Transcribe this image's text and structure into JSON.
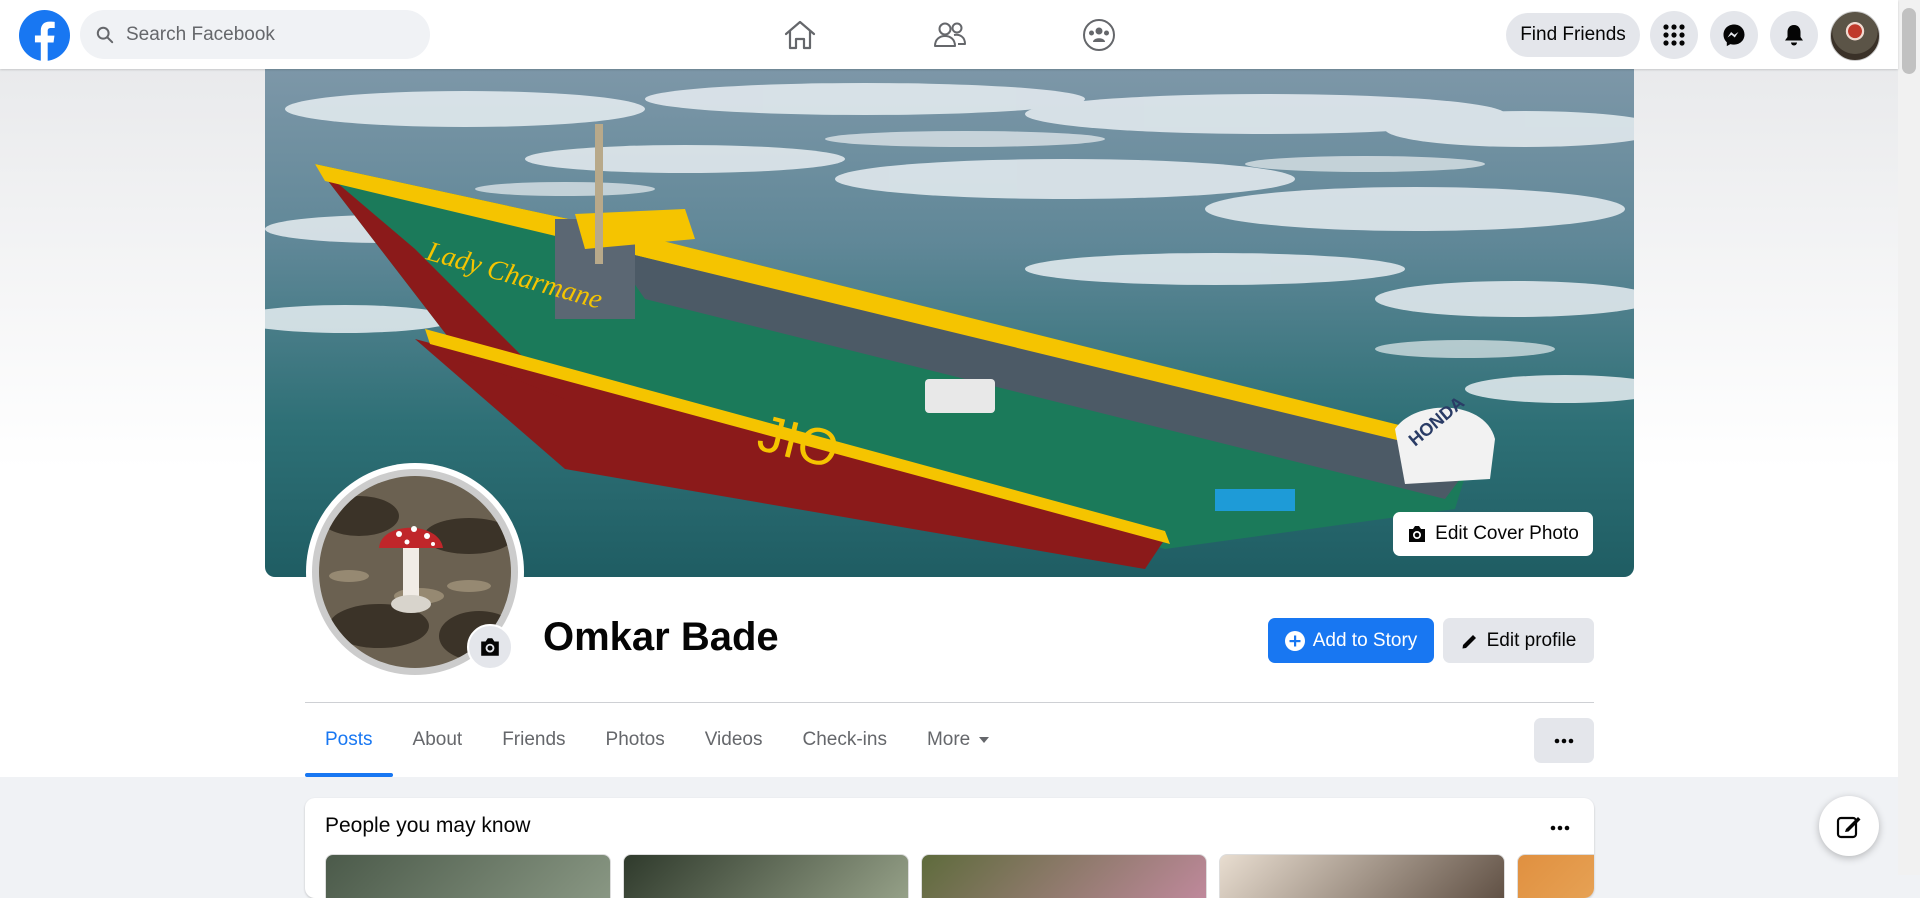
{
  "topbar": {
    "search_placeholder": "Search Facebook",
    "find_friends_label": "Find Friends",
    "nav_icons": [
      "home-icon",
      "friends-icon",
      "groups-icon"
    ],
    "right_icons": [
      "menu-grid-icon",
      "messenger-icon",
      "notifications-icon"
    ]
  },
  "cover": {
    "edit_label": "Edit Cover Photo",
    "boat_name": "Lady Charmane",
    "boat_number": "JIO",
    "motor_brand": "HONDA"
  },
  "profile": {
    "name": "Omkar Bade",
    "add_story_label": "Add to Story",
    "edit_profile_label": "Edit profile"
  },
  "tabs": [
    {
      "label": "Posts",
      "active": true
    },
    {
      "label": "About",
      "active": false
    },
    {
      "label": "Friends",
      "active": false
    },
    {
      "label": "Photos",
      "active": false
    },
    {
      "label": "Videos",
      "active": false
    },
    {
      "label": "Check-ins",
      "active": false
    },
    {
      "label": "More",
      "active": false
    }
  ],
  "pymk": {
    "title": "People you may know"
  },
  "colors": {
    "accent": "#1877f2",
    "button_gray": "#e4e6eb",
    "page_bg": "#f0f2f5",
    "boat_yellow": "#f5c400",
    "boat_green": "#1b7a5a",
    "boat_red": "#8b1a1a"
  }
}
